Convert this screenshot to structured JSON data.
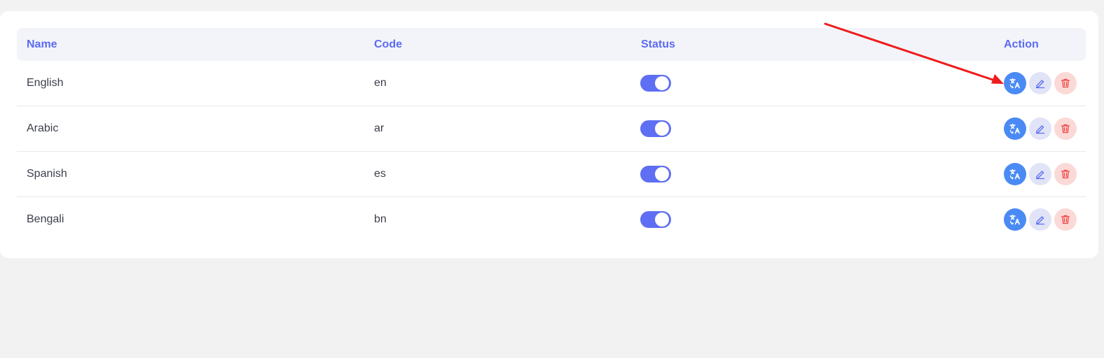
{
  "table": {
    "columns": {
      "name": "Name",
      "code": "Code",
      "status": "Status",
      "action": "Action"
    },
    "rows": [
      {
        "name": "English",
        "code": "en",
        "status_enabled": true
      },
      {
        "name": "Arabic",
        "code": "ar",
        "status_enabled": true
      },
      {
        "name": "Spanish",
        "code": "es",
        "status_enabled": true
      },
      {
        "name": "Bengali",
        "code": "bn",
        "status_enabled": true
      }
    ]
  },
  "icons": {
    "translate": "translate-icon",
    "edit": "pencil-icon",
    "delete": "trash-icon"
  },
  "colors": {
    "header_text": "#5a6bf2",
    "toggle_on": "#5e6ff3",
    "translate_button": "#4a8af4",
    "edit_button_bg": "#e1e4f7",
    "delete_button_bg": "#fbd9d6",
    "delete_icon": "#ef4444",
    "annotation_arrow": "#ee1c1c"
  },
  "annotation": {
    "type": "arrow",
    "points_to": "translate button in first row"
  }
}
